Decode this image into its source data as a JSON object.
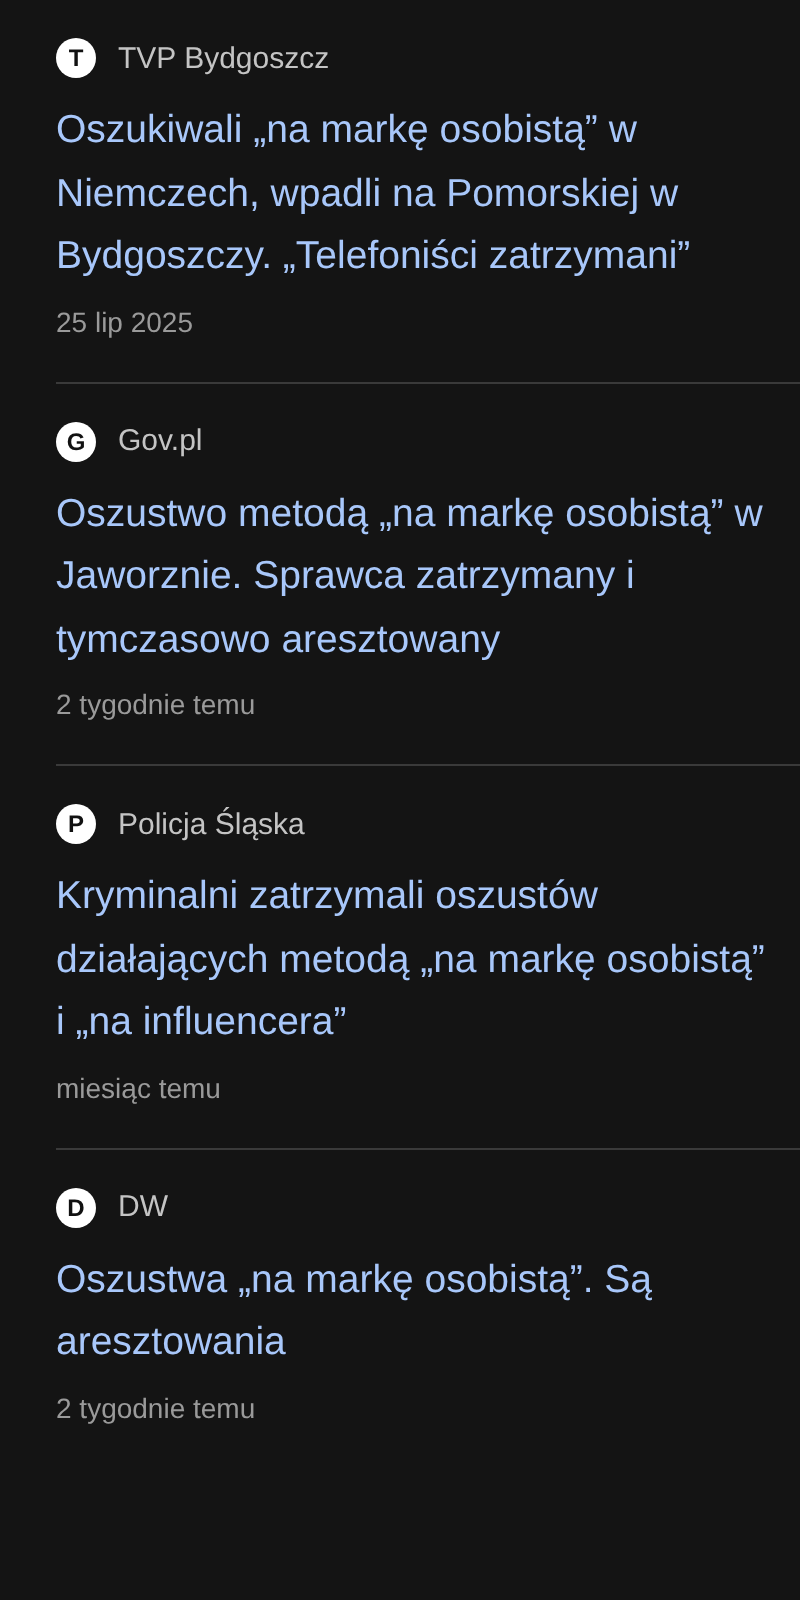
{
  "articles": [
    {
      "source_initial": "T",
      "source": "TVP Bydgoszcz",
      "title": "Oszukiwali „na markę osobistą” w Niemczech, wpadli na Pomorskiej w Bydgoszczy. „Telefoniści zatrzymani”",
      "time": "25 lip 2025"
    },
    {
      "source_initial": "G",
      "source": "Gov.pl",
      "title": "Oszustwo metodą „na markę osobistą” w Jaworznie. Sprawca zatrzymany i tymczasowo aresztowany",
      "time": "2 tygodnie temu"
    },
    {
      "source_initial": "P",
      "source": "Policja Śląska",
      "title": "Kryminalni zatrzymali oszustów działających metodą „na markę osobistą” i „na influencera”",
      "time": "miesiąc temu"
    },
    {
      "source_initial": "D",
      "source": "DW",
      "title": "Oszustwa „na markę osobistą”. Są aresztowania",
      "time": "2 tygodnie temu"
    }
  ]
}
